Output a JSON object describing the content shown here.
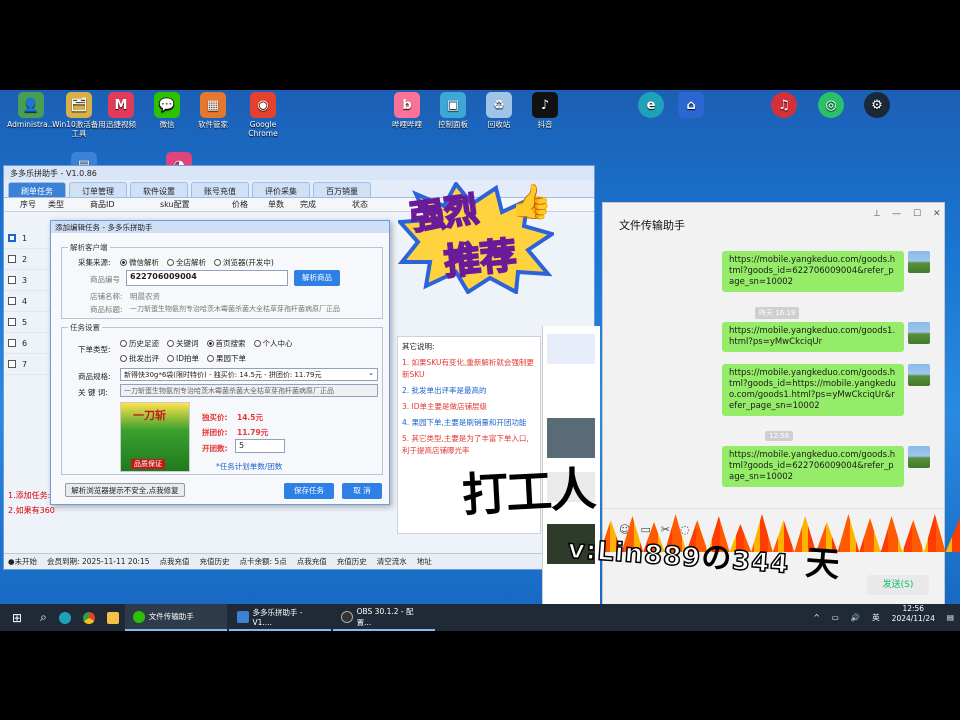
{
  "desktop_icons": [
    {
      "label": "Administra...",
      "color": "#4a9d55",
      "glyph": "👤"
    },
    {
      "label": "Win10激活备用工具",
      "color": "#d8b04a",
      "glyph": "🗂"
    },
    {
      "label": "迅捷视频",
      "color": "#e23b5a",
      "glyph": "M"
    },
    {
      "label": "微信",
      "color": "#2dc100",
      "glyph": "💬"
    },
    {
      "label": "软件管家",
      "color": "#e6772e",
      "glyph": "▦"
    },
    {
      "label": "Google Chrome",
      "color": "#e4412e",
      "glyph": "◉"
    },
    {
      "label": "哔哩哔哩",
      "color": "#fb7299",
      "glyph": "b"
    },
    {
      "label": "控制面板",
      "color": "#3fa7d6",
      "glyph": "▣"
    },
    {
      "label": "回收站",
      "color": "#9fc4e8",
      "glyph": "♻"
    },
    {
      "label": "抖音",
      "color": "#111111",
      "glyph": "♪"
    }
  ],
  "app": {
    "title": "多多乐拼助手 - V1.0.86",
    "tabs": [
      "刷单任务",
      "订单管理",
      "软件设置",
      "账号充值",
      "评价采集",
      "百万销量"
    ],
    "columns": [
      "序号",
      "类型",
      "商品ID",
      "sku配置",
      "价格",
      "单数",
      "完成",
      "状态"
    ],
    "row_numbers": [
      "1",
      "2",
      "3",
      "4",
      "5",
      "6",
      "7"
    ],
    "log": [
      "1.添加任务:",
      "2.如果有360"
    ],
    "status": [
      "●未开始",
      "会员到期: 2025-11-11 20:15",
      "点我充值",
      "充值历史",
      "点卡余额: 5点",
      "点我充值",
      "充值历史",
      "清空流水",
      "地址"
    ]
  },
  "dialog": {
    "title": "添加编辑任务 - 多多乐拼助手",
    "group_parse": "解析客户端",
    "source_label": "采集来源:",
    "source_options": [
      "微信解析",
      "全店解析",
      "浏览器(开发中)"
    ],
    "product_id_label": "商品编号",
    "product_id_value": "622706009004",
    "parse_button": "解析商品",
    "shop_label": "店铺名称:",
    "shop_value": "明晨农资",
    "title_label": "商品标题:",
    "title_value": "一刀斩蛋生物氨剂专治哈茨木霉菌杀菌大全枯草芽孢杆菌病原厂正品",
    "group_task": "任务设置",
    "order_type_label": "下单类型:",
    "order_types_row1": [
      "历史足迹",
      "关键词",
      "首页搜索",
      "个人中心"
    ],
    "order_types_row2": [
      "批发出评",
      "ID拍单",
      "果园下单"
    ],
    "spec_label": "商品规格:",
    "spec_value": "新得快30g*6袋(限时特价) - 独买价: 14.5元 - 拼团价: 11.79元",
    "keyword_label": "关 键 词:",
    "keyword_value": "一刀斩蛋生物氨剂专治哈茨木霉菌杀菌大全枯草芽孢杆菌病原厂正品",
    "solo_price_label": "独买价:",
    "solo_price": "14.5元",
    "group_price_label": "拼团价:",
    "group_price": "11.79元",
    "group_count_label": "开团数:",
    "group_count": "5",
    "task_plan": "*任务计划单数/团数",
    "browser_warning_button": "解析浏览器提示不安全,点我修复",
    "save_button": "保存任务",
    "cancel_button": "取 消",
    "product_image_text": "一刀斩",
    "product_image_sub": "品质保证"
  },
  "notes": {
    "title": "其它说明:",
    "items": [
      {
        "text": "1. 如果SKU有变化,重新解析就会强制更新SKU",
        "color": "#e53935"
      },
      {
        "text": "2. 批发单出评率是最高的",
        "color": "#1e63c9"
      },
      {
        "text": "3. ID单主要是做店铺层级",
        "color": "#e53935"
      },
      {
        "text": "4. 果园下单,主要是刷销量和开团功能",
        "color": "#1e63c9"
      },
      {
        "text": "5. 其它类型,主要是为了丰富下单入口,利于提高店铺曝光率",
        "color": "#e53935"
      }
    ]
  },
  "chat": {
    "title": "文件传输助手",
    "messages": [
      {
        "type": "msg",
        "text": "https://mobile.yangkeduo.com/goods.html?goods_id=622706009004&refer_page_sn=10002"
      },
      {
        "type": "time",
        "text": "昨天 16:19"
      },
      {
        "type": "msg",
        "text": "https://mobile.yangkeduo.com/goods1.html?ps=yMwCkciqUr"
      },
      {
        "type": "msg",
        "text": "https://mobile.yangkeduo.com/goods.html?goods_id=https://mobile.yangkeduo.com/goods1.html?ps=yMwCkciqUr&refer_page_sn=10002"
      },
      {
        "type": "time",
        "text": "12:56"
      },
      {
        "type": "msg",
        "text": "https://mobile.yangkeduo.com/goods.html?goods_id=622706009004&refer_page_sn=10002"
      }
    ],
    "send_button": "发送(S)",
    "toolbar_icons": [
      "emoji-icon",
      "folder-icon",
      "scissors-icon",
      "chat-history-icon"
    ]
  },
  "overlay": {
    "sticker_line1": "强烈",
    "sticker_line2": "推荐",
    "big_caption": "打工人",
    "contact": "v:Lin889",
    "contact_tail": "344",
    "suffix": "天"
  },
  "taskbar": {
    "apps": [
      "文件传输助手",
      "多多乐拼助手 - V1....",
      "OBS 30.1.2 - 配置..."
    ],
    "ime": "英",
    "time": "12:56",
    "date": "2024/11/24"
  }
}
